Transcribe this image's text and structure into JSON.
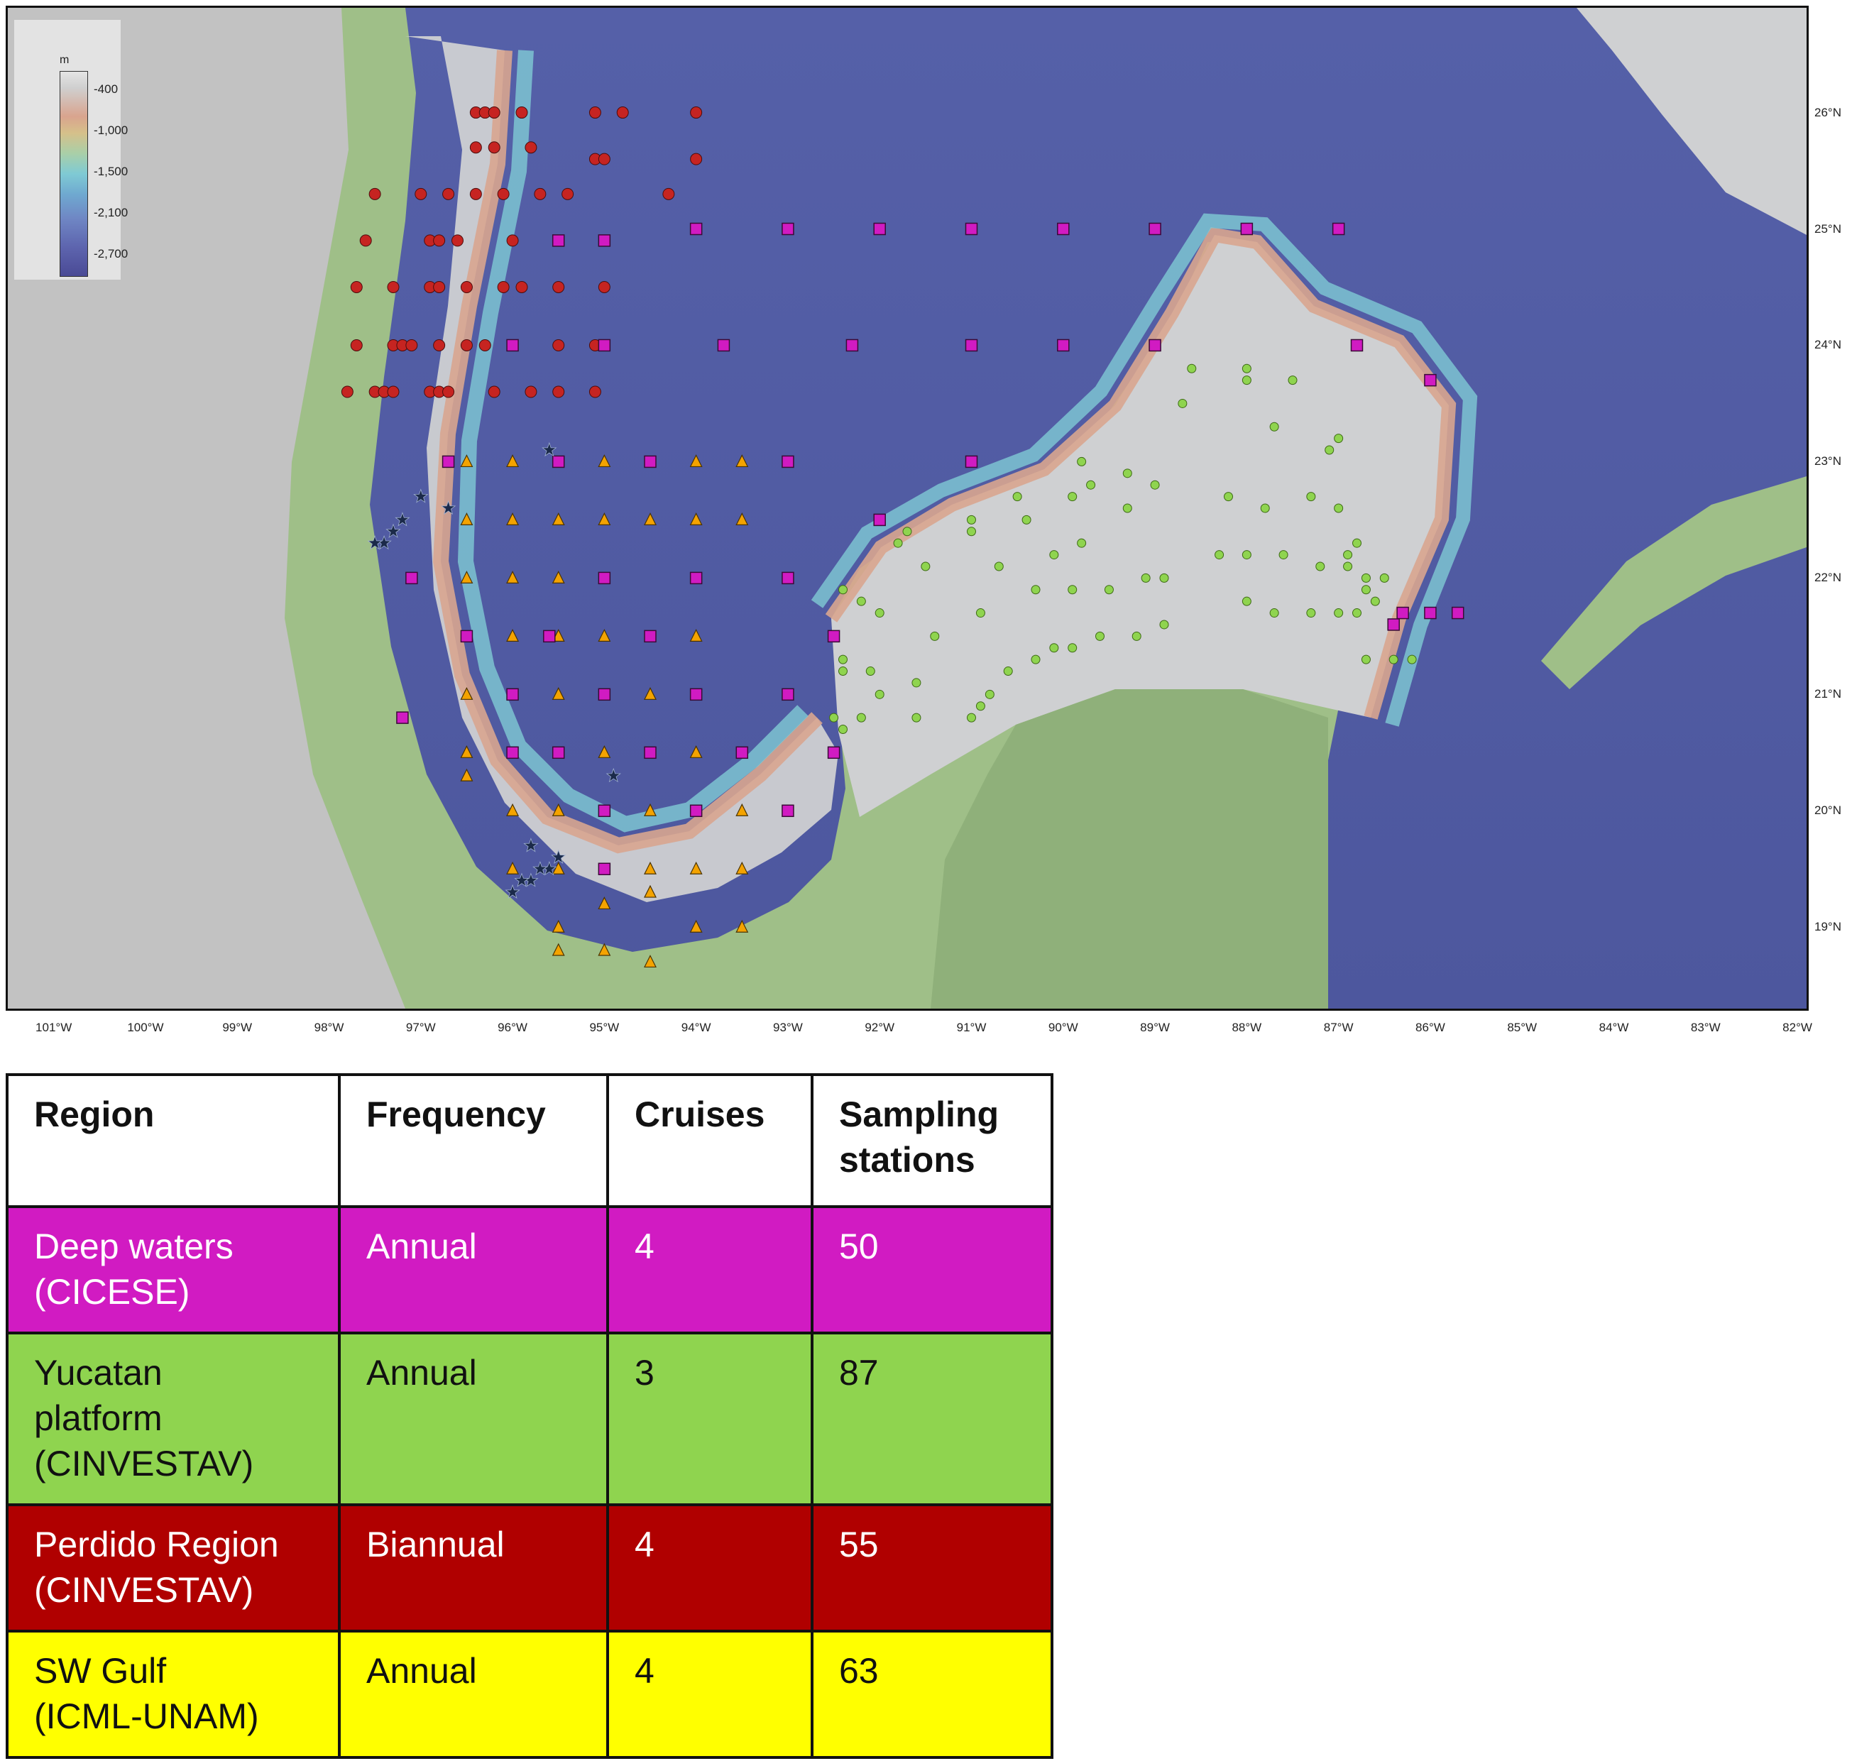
{
  "colors": {
    "deep_waters": "#d11bc2",
    "yucatan": "#8fd44f",
    "perdido": "#b00000",
    "sw_gulf": "#ffff00",
    "perdido_marker": "#c62421",
    "sw_marker": "#f4a300",
    "star_marker": "#1b2a4a"
  },
  "map": {
    "legend": {
      "unit": "m",
      "levels": [
        "-400",
        "-1,000",
        "-1,500",
        "-2,100",
        "-2,700"
      ]
    },
    "lat_ticks": [
      "26°N",
      "25°N",
      "24°N",
      "23°N",
      "22°N",
      "21°N",
      "20°N",
      "19°N"
    ],
    "lon_ticks": [
      "101°W",
      "100°W",
      "99°W",
      "98°W",
      "97°W",
      "96°W",
      "95°W",
      "94°W",
      "93°W",
      "92°W",
      "91°W",
      "90°W",
      "89°W",
      "88°W",
      "87°W",
      "86°W",
      "85°W",
      "84°W",
      "83°W",
      "82°W"
    ],
    "lon_range": [
      -101.5,
      -81.9
    ],
    "lat_range": [
      18.3,
      26.9
    ],
    "stations": {
      "deep_squares": [
        [
          -94,
          25
        ],
        [
          -93,
          25
        ],
        [
          -92,
          25
        ],
        [
          -91,
          25
        ],
        [
          -90,
          25
        ],
        [
          -89,
          25
        ],
        [
          -88,
          25
        ],
        [
          -87,
          25
        ],
        [
          -95.5,
          24.9
        ],
        [
          -95,
          24.9
        ],
        [
          -96,
          24
        ],
        [
          -95,
          24
        ],
        [
          -93.7,
          24
        ],
        [
          -92.3,
          24
        ],
        [
          -91,
          24
        ],
        [
          -90,
          24
        ],
        [
          -89,
          24
        ],
        [
          -86.8,
          24
        ],
        [
          -86,
          23.7
        ],
        [
          -96.7,
          23
        ],
        [
          -95.5,
          23
        ],
        [
          -94.5,
          23
        ],
        [
          -93,
          23
        ],
        [
          -91,
          23
        ],
        [
          -92,
          22.5
        ],
        [
          -97.1,
          22
        ],
        [
          -95,
          22
        ],
        [
          -94,
          22
        ],
        [
          -93,
          22
        ],
        [
          -96.5,
          21.5
        ],
        [
          -95.6,
          21.5
        ],
        [
          -94.5,
          21.5
        ],
        [
          -92.5,
          21.5
        ],
        [
          -96,
          21
        ],
        [
          -95,
          21
        ],
        [
          -94,
          21
        ],
        [
          -93,
          21
        ],
        [
          -97.2,
          20.8
        ],
        [
          -96,
          20.5
        ],
        [
          -95.5,
          20.5
        ],
        [
          -94.5,
          20.5
        ],
        [
          -93.5,
          20.5
        ],
        [
          -92.5,
          20.5
        ],
        [
          -95,
          20
        ],
        [
          -94,
          20
        ],
        [
          -93,
          20
        ],
        [
          -95,
          19.5
        ],
        [
          -86.4,
          21.6
        ],
        [
          -86.3,
          21.7
        ],
        [
          -86,
          21.7
        ],
        [
          -85.7,
          21.7
        ]
      ],
      "perdido_circles": [
        [
          -96.4,
          26
        ],
        [
          -96.3,
          26
        ],
        [
          -96.2,
          26
        ],
        [
          -95.9,
          26
        ],
        [
          -95.1,
          26
        ],
        [
          -94.8,
          26
        ],
        [
          -94,
          26
        ],
        [
          -96.4,
          25.7
        ],
        [
          -96.2,
          25.7
        ],
        [
          -95.8,
          25.7
        ],
        [
          -95.1,
          25.6
        ],
        [
          -95,
          25.6
        ],
        [
          -94,
          25.6
        ],
        [
          -97.5,
          25.3
        ],
        [
          -97,
          25.3
        ],
        [
          -96.7,
          25.3
        ],
        [
          -96.4,
          25.3
        ],
        [
          -96.1,
          25.3
        ],
        [
          -95.7,
          25.3
        ],
        [
          -95.4,
          25.3
        ],
        [
          -94.3,
          25.3
        ],
        [
          -97.6,
          24.9
        ],
        [
          -96.9,
          24.9
        ],
        [
          -96.8,
          24.9
        ],
        [
          -96.6,
          24.9
        ],
        [
          -96,
          24.9
        ],
        [
          -97.7,
          24.5
        ],
        [
          -97.3,
          24.5
        ],
        [
          -96.9,
          24.5
        ],
        [
          -96.8,
          24.5
        ],
        [
          -96.5,
          24.5
        ],
        [
          -96.1,
          24.5
        ],
        [
          -95.9,
          24.5
        ],
        [
          -95.5,
          24.5
        ],
        [
          -95,
          24.5
        ],
        [
          -97.7,
          24
        ],
        [
          -97.3,
          24
        ],
        [
          -97.2,
          24
        ],
        [
          -97.1,
          24
        ],
        [
          -96.8,
          24
        ],
        [
          -96.5,
          24
        ],
        [
          -96.3,
          24
        ],
        [
          -95.5,
          24
        ],
        [
          -95.1,
          24
        ],
        [
          -97.8,
          23.6
        ],
        [
          -97.5,
          23.6
        ],
        [
          -97.4,
          23.6
        ],
        [
          -97.3,
          23.6
        ],
        [
          -96.9,
          23.6
        ],
        [
          -96.8,
          23.6
        ],
        [
          -96.7,
          23.6
        ],
        [
          -96.2,
          23.6
        ],
        [
          -95.8,
          23.6
        ],
        [
          -95.5,
          23.6
        ],
        [
          -95.1,
          23.6
        ]
      ],
      "sw_triangles": [
        [
          -96.5,
          23
        ],
        [
          -96,
          23
        ],
        [
          -95,
          23
        ],
        [
          -94,
          23
        ],
        [
          -93.5,
          23
        ],
        [
          -96.5,
          22.5
        ],
        [
          -96,
          22.5
        ],
        [
          -95.5,
          22.5
        ],
        [
          -95,
          22.5
        ],
        [
          -94.5,
          22.5
        ],
        [
          -94,
          22.5
        ],
        [
          -93.5,
          22.5
        ],
        [
          -96.5,
          22
        ],
        [
          -96,
          22
        ],
        [
          -95.5,
          22
        ],
        [
          -96,
          21.5
        ],
        [
          -95.5,
          21.5
        ],
        [
          -95,
          21.5
        ],
        [
          -94,
          21.5
        ],
        [
          -96.5,
          21
        ],
        [
          -95.5,
          21
        ],
        [
          -94.5,
          21
        ],
        [
          -96.5,
          20.5
        ],
        [
          -96.5,
          20.3
        ],
        [
          -95,
          20.5
        ],
        [
          -94,
          20.5
        ],
        [
          -96,
          20
        ],
        [
          -95.5,
          20
        ],
        [
          -94.5,
          20
        ],
        [
          -93.5,
          20
        ],
        [
          -96,
          19.5
        ],
        [
          -95.5,
          19.5
        ],
        [
          -94.5,
          19.5
        ],
        [
          -94,
          19.5
        ],
        [
          -93.5,
          19.5
        ],
        [
          -95,
          19.2
        ],
        [
          -94.5,
          19.3
        ],
        [
          -95.5,
          19
        ],
        [
          -94,
          19
        ],
        [
          -93.5,
          19
        ],
        [
          -95.5,
          18.8
        ],
        [
          -95,
          18.8
        ],
        [
          -94.5,
          18.7
        ]
      ],
      "yucatan_circles": [
        [
          -88.6,
          23.8
        ],
        [
          -88,
          23.7
        ],
        [
          -87.5,
          23.7
        ],
        [
          -88.7,
          23.5
        ],
        [
          -88,
          23.8
        ],
        [
          -87.7,
          23.3
        ],
        [
          -87,
          23.2
        ],
        [
          -87.1,
          23.1
        ],
        [
          -89.8,
          23
        ],
        [
          -89.3,
          22.9
        ],
        [
          -89.7,
          22.8
        ],
        [
          -89,
          22.8
        ],
        [
          -90.5,
          22.7
        ],
        [
          -89.9,
          22.7
        ],
        [
          -88.2,
          22.7
        ],
        [
          -87.3,
          22.7
        ],
        [
          -87.8,
          22.6
        ],
        [
          -90.4,
          22.5
        ],
        [
          -91,
          22.5
        ],
        [
          -89.3,
          22.6
        ],
        [
          -87,
          22.6
        ],
        [
          -91.7,
          22.4
        ],
        [
          -89.8,
          22.3
        ],
        [
          -91,
          22.4
        ],
        [
          -91.8,
          22.3
        ],
        [
          -86.8,
          22.3
        ],
        [
          -86.9,
          22.2
        ],
        [
          -87.6,
          22.2
        ],
        [
          -88.3,
          22.2
        ],
        [
          -86.9,
          22.1
        ],
        [
          -90.1,
          22.2
        ],
        [
          -91.5,
          22.1
        ],
        [
          -90.7,
          22.1
        ],
        [
          -88,
          22.2
        ],
        [
          -87.2,
          22.1
        ],
        [
          -89.1,
          22
        ],
        [
          -88.9,
          22
        ],
        [
          -86.7,
          22
        ],
        [
          -86.5,
          22
        ],
        [
          -92.4,
          21.9
        ],
        [
          -89.5,
          21.9
        ],
        [
          -92.2,
          21.8
        ],
        [
          -92,
          21.7
        ],
        [
          -90.3,
          21.9
        ],
        [
          -89.9,
          21.9
        ],
        [
          -88,
          21.8
        ],
        [
          -87.7,
          21.7
        ],
        [
          -86.7,
          21.9
        ],
        [
          -86.6,
          21.8
        ],
        [
          -86.8,
          21.7
        ],
        [
          -90.9,
          21.7
        ],
        [
          -87.3,
          21.7
        ],
        [
          -87,
          21.7
        ],
        [
          -88.9,
          21.6
        ],
        [
          -89.6,
          21.5
        ],
        [
          -91.4,
          21.5
        ],
        [
          -89.2,
          21.5
        ],
        [
          -89.9,
          21.4
        ],
        [
          -90.1,
          21.4
        ],
        [
          -86.4,
          21.3
        ],
        [
          -90.3,
          21.3
        ],
        [
          -86.2,
          21.3
        ],
        [
          -86.7,
          21.3
        ],
        [
          -92.4,
          21.3
        ],
        [
          -92.4,
          21.2
        ],
        [
          -92.1,
          21.2
        ],
        [
          -90.6,
          21.2
        ],
        [
          -91.6,
          21.1
        ],
        [
          -90.8,
          21
        ],
        [
          -92,
          21
        ],
        [
          -90.9,
          20.9
        ],
        [
          -92.5,
          20.8
        ],
        [
          -91.6,
          20.8
        ],
        [
          -92.2,
          20.8
        ],
        [
          -91,
          20.8
        ],
        [
          -92.4,
          20.7
        ]
      ],
      "stars": [
        [
          -95.6,
          23.1
        ],
        [
          -97,
          22.7
        ],
        [
          -96.7,
          22.6
        ],
        [
          -97.2,
          22.5
        ],
        [
          -97.3,
          22.4
        ],
        [
          -97.4,
          22.3
        ],
        [
          -97.5,
          22.3
        ],
        [
          -95.8,
          19.7
        ],
        [
          -95.5,
          19.6
        ],
        [
          -95.6,
          19.5
        ],
        [
          -95.7,
          19.5
        ],
        [
          -95.8,
          19.4
        ],
        [
          -95.9,
          19.4
        ],
        [
          -96,
          19.3
        ],
        [
          -94.9,
          20.3
        ]
      ]
    }
  },
  "table": {
    "headers": {
      "region": "Region",
      "frequency": "Frequency",
      "cruises": "Cruises",
      "sampling_line1": "Sampling",
      "sampling_line2": "stations"
    },
    "rows": [
      {
        "region_line1": "Deep waters",
        "region_line2": "(CICESE)",
        "region_line3": "",
        "frequency": "Annual",
        "cruises": "4",
        "stations": "50",
        "bg": "#d11bc2",
        "fg": "#ffffff"
      },
      {
        "region_line1": "Yucatan",
        "region_line2": "platform",
        "region_line3": "(CINVESTAV)",
        "frequency": "Annual",
        "cruises": "3",
        "stations": "87",
        "bg": "#8fd44f",
        "fg": "#111111"
      },
      {
        "region_line1": "Perdido Region",
        "region_line2": "(CINVESTAV)",
        "region_line3": "",
        "frequency": "Biannual",
        "cruises": "4",
        "stations": "55",
        "bg": "#b00000",
        "fg": "#ffffff"
      },
      {
        "region_line1": "SW Gulf",
        "region_line2": "(ICML-UNAM)",
        "region_line3": "",
        "frequency": "Annual",
        "cruises": "4",
        "stations": "63",
        "bg": "#ffff00",
        "fg": "#111111"
      }
    ]
  }
}
